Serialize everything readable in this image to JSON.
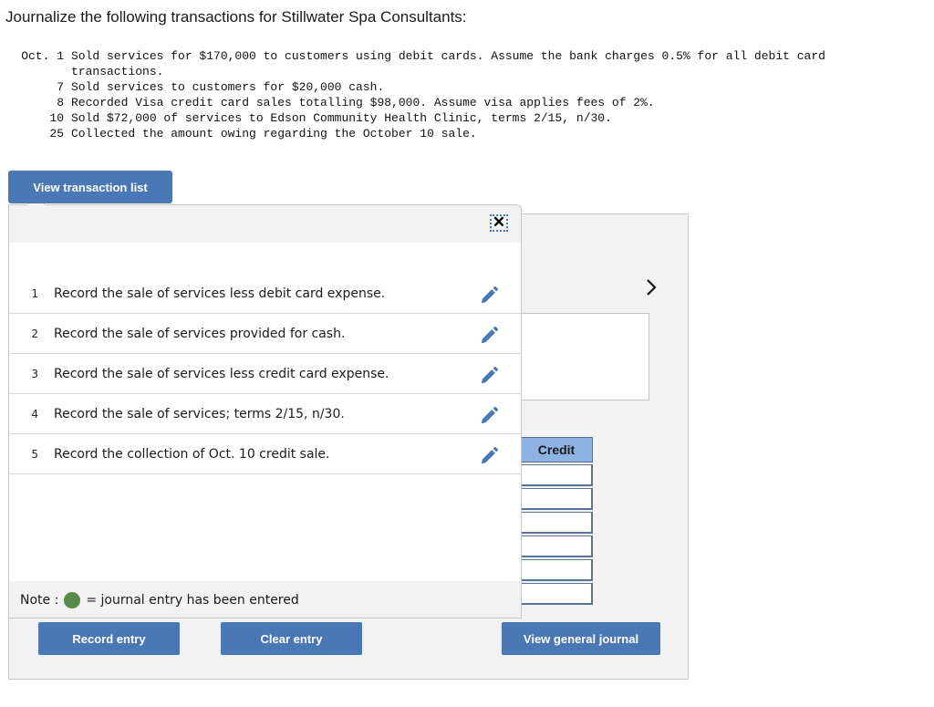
{
  "title": "Journalize the following transactions for Stillwater Spa Consultants:",
  "transactions": [
    {
      "date": "Oct. 1",
      "text": "Sold services for $170,000 to customers using debit cards. Assume the bank charges 0.5% for all debit card\ntransactions."
    },
    {
      "date": "7",
      "text": "Sold services to customers for $20,000 cash."
    },
    {
      "date": "8",
      "text": "Recorded Visa credit card sales totalling $98,000. Assume visa applies fees of 2%."
    },
    {
      "date": "10",
      "text": "Sold $72,000 of services to Edson Community Health Clinic, terms 2/15, n/30."
    },
    {
      "date": "25",
      "text": "Collected the amount owing regarding the October 10 sale."
    }
  ],
  "buttons": {
    "view_transaction_list": "View transaction list",
    "record_entry": "Record entry",
    "clear_entry": "Clear entry",
    "view_general_journal": "View general journal",
    "close": "✕"
  },
  "transaction_list": [
    {
      "num": "1",
      "text": "Record the sale of services less debit card expense."
    },
    {
      "num": "2",
      "text": "Record the sale of services provided for cash."
    },
    {
      "num": "3",
      "text": "Record the sale of services less credit card expense."
    },
    {
      "num": "4",
      "text": "Record the sale of services; terms 2/15, n/30."
    },
    {
      "num": "5",
      "text": "Record the collection of Oct. 10 credit sale."
    }
  ],
  "note": {
    "prefix": "Note :",
    "suffix": "= journal entry has been entered",
    "dot_color": "#5a8a4a"
  },
  "journal": {
    "credit_header": "Credit",
    "credit_values": [
      "",
      "",
      "",
      "",
      "",
      ""
    ]
  },
  "colors": {
    "accent": "#4a78b5",
    "header_blue": "#8db3e2"
  }
}
